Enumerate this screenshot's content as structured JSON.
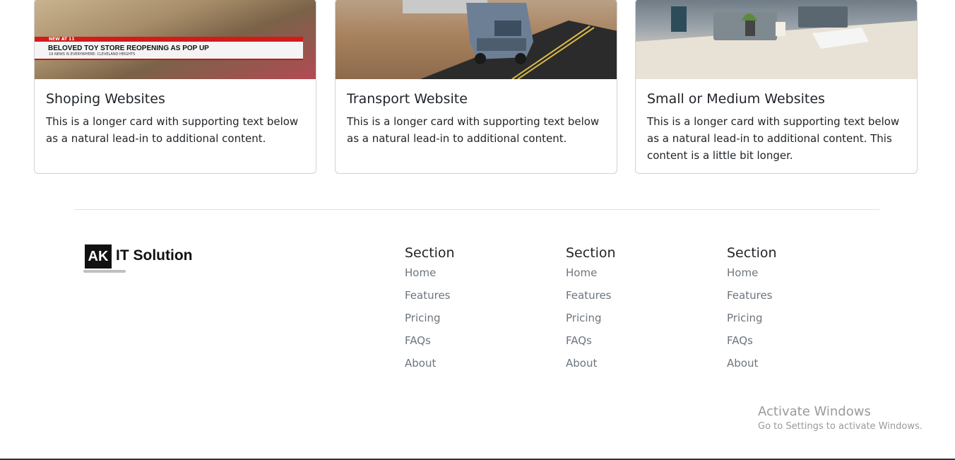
{
  "cards": [
    {
      "title": "Shoping Websites",
      "text": "This is a longer card with supporting text below as a natural lead-in to additional content.",
      "banner_top": "NEW AT 11",
      "banner_headline": "BELOVED TOY STORE REOPENING AS POP UP",
      "banner_sub": "19 NEWS IS EVERYWHERE: CLEVELAND HEIGHTS"
    },
    {
      "title": "Transport Website",
      "text": "This is a longer card with supporting text below as a natural lead-in to additional content."
    },
    {
      "title": "Small or Medium Websites",
      "text": "This is a longer card with supporting text below as a natural lead-in to additional content. This content is a little bit longer."
    }
  ],
  "footer": {
    "logo_mark": "AK",
    "logo_text": "IT Solution",
    "sections": [
      {
        "heading": "Section",
        "links": [
          "Home",
          "Features",
          "Pricing",
          "FAQs",
          "About"
        ]
      },
      {
        "heading": "Section",
        "links": [
          "Home",
          "Features",
          "Pricing",
          "FAQs",
          "About"
        ]
      },
      {
        "heading": "Section",
        "links": [
          "Home",
          "Features",
          "Pricing",
          "FAQs",
          "About"
        ]
      }
    ]
  },
  "watermark": {
    "title": "Activate Windows",
    "subtitle": "Go to Settings to activate Windows."
  }
}
